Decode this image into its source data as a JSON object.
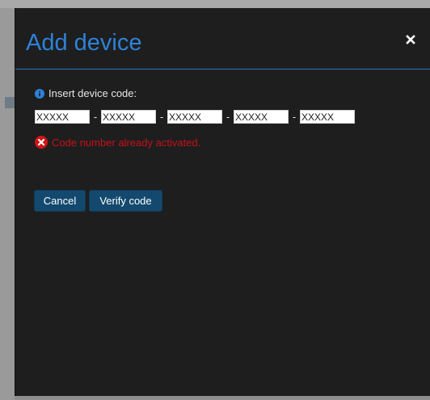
{
  "dialog": {
    "title": "Add device",
    "close_icon": "close-icon"
  },
  "form": {
    "label": "Insert device code:",
    "label_icon": "info-icon",
    "separator": "-",
    "code_fields": [
      {
        "value": "XXXXX"
      },
      {
        "value": "XXXXX"
      },
      {
        "value": "XXXXX"
      },
      {
        "value": "XXXXX"
      },
      {
        "value": "XXXXX"
      }
    ]
  },
  "error": {
    "icon": "error-icon",
    "message": "Code number already activated."
  },
  "buttons": {
    "cancel_label": "Cancel",
    "verify_label": "Verify code"
  },
  "colors": {
    "dialog_bg": "#1e1e1e",
    "title": "#2d82d8",
    "error": "#c8101a",
    "button_bg": "#14496f"
  }
}
